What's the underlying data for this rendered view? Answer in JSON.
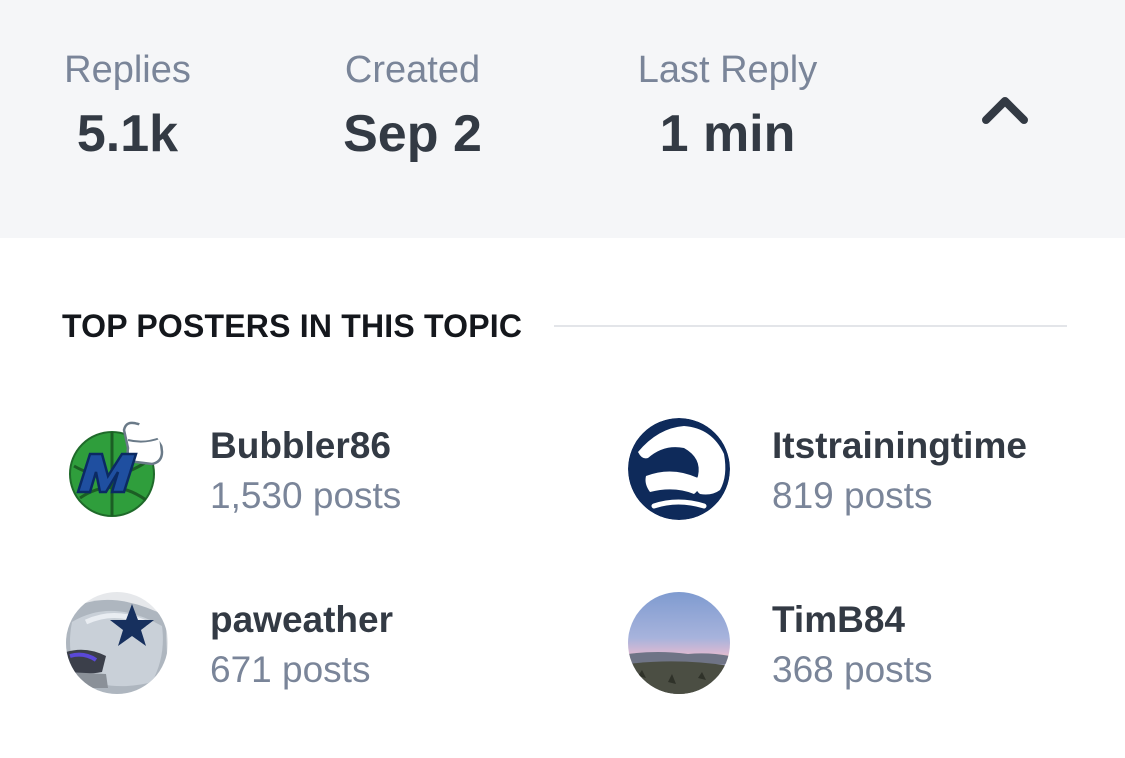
{
  "topic_stats": {
    "replies": {
      "label": "Replies",
      "value": "5.1k"
    },
    "created": {
      "label": "Created",
      "value": "Sep 2"
    },
    "last_reply": {
      "label": "Last Reply",
      "value": "1 min"
    },
    "collapse_icon": "chevron-up-icon"
  },
  "top_posters": {
    "title": "TOP POSTERS IN THIS TOPIC",
    "items": [
      {
        "name": "Bubbler86",
        "posts": "1,530 posts",
        "avatar": "mavericks-logo-avatar"
      },
      {
        "name": "Itstrainingtime",
        "posts": "819 posts",
        "avatar": "penn-state-lion-avatar"
      },
      {
        "name": "paweather",
        "posts": "671 posts",
        "avatar": "cowboys-helmet-avatar"
      },
      {
        "name": "TimB84",
        "posts": "368 posts",
        "avatar": "sunset-photo-avatar"
      }
    ]
  },
  "colors": {
    "stats_background": "#f5f6f8",
    "label_gray": "#7a8599",
    "value_dark": "#333a44",
    "heading_black": "#14171c"
  }
}
